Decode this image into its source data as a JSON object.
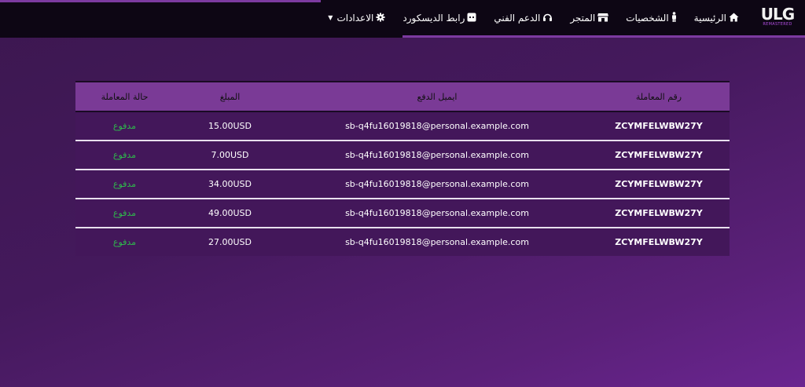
{
  "brand": {
    "logo_text": "ULG",
    "logo_subtext": "REMASTERED"
  },
  "nav": {
    "items": [
      {
        "label": "الرئيسية",
        "icon": "home-icon"
      },
      {
        "label": "الشخصيات",
        "icon": "person-icon"
      },
      {
        "label": "المتجر",
        "icon": "store-icon"
      },
      {
        "label": "الدعم الفني",
        "icon": "headset-icon"
      },
      {
        "label": "رابط الديسكورد",
        "icon": "discord-icon"
      },
      {
        "label": "الاعدادات",
        "icon": "gear-icon"
      }
    ]
  },
  "table": {
    "headers": {
      "transaction_id": "رقم المعاملة",
      "payment_email": "ايميل الدفع",
      "amount": "المبلغ",
      "status": "حالة المعاملة"
    },
    "rows": [
      {
        "transaction_id": "ZCYMFELWBW27Y",
        "payment_email": "sb-q4fu16019818@personal.example.com",
        "amount": "15.00USD",
        "status": "مدفوع"
      },
      {
        "transaction_id": "ZCYMFELWBW27Y",
        "payment_email": "sb-q4fu16019818@personal.example.com",
        "amount": "7.00USD",
        "status": "مدفوع"
      },
      {
        "transaction_id": "ZCYMFELWBW27Y",
        "payment_email": "sb-q4fu16019818@personal.example.com",
        "amount": "34.00USD",
        "status": "مدفوع"
      },
      {
        "transaction_id": "ZCYMFELWBW27Y",
        "payment_email": "sb-q4fu16019818@personal.example.com",
        "amount": "49.00USD",
        "status": "مدفوع"
      },
      {
        "transaction_id": "ZCYMFELWBW27Y",
        "payment_email": "sb-q4fu16019818@personal.example.com",
        "amount": "27.00USD",
        "status": "مدفوع"
      }
    ]
  },
  "colors": {
    "accent": "#7c3aa0",
    "header_row": "#7a3a96",
    "row_bg": "#43175a",
    "status_paid": "#2fb64c"
  }
}
